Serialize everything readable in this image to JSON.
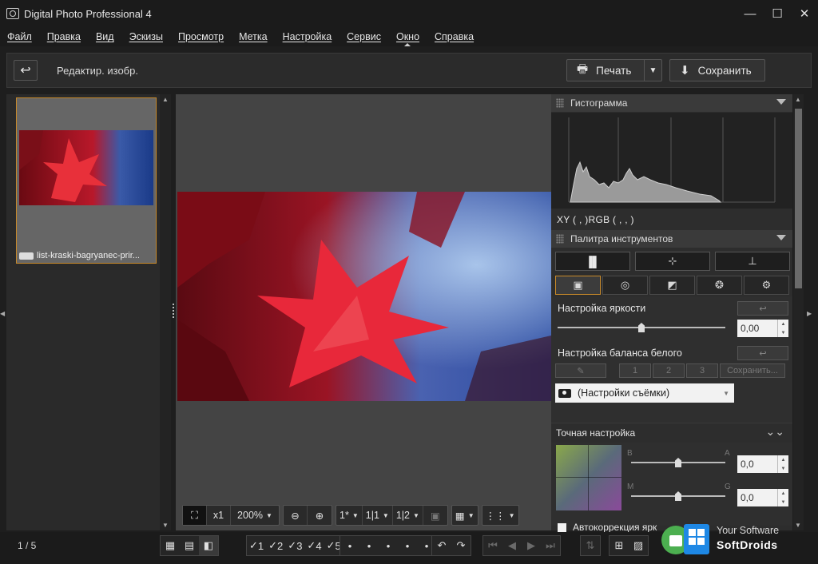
{
  "window": {
    "title": "Digital Photo Professional 4",
    "minimize": "—",
    "maximize": "☐",
    "close": "✕"
  },
  "menu": [
    "Файл",
    "Правка",
    "Вид",
    "Эскизы",
    "Просмотр",
    "Метка",
    "Настройка",
    "Сервис",
    "Окно",
    "Справка"
  ],
  "toolbar": {
    "back_icon": "↩",
    "mode_label": "Редактир. изобр.",
    "print_label": "Печать",
    "save_label": "Сохранить"
  },
  "thumbnail": {
    "filename": "list-kraski-bagryanec-prir..."
  },
  "zoom_bar": {
    "fit_icon": "⛶",
    "one_x": "x1",
    "zoom_value": "200%",
    "zoom_out": "⊖",
    "zoom_in": "⊕",
    "view_1": "1*",
    "view_11": "1|1",
    "view_12": "1|2",
    "grid_icon": "▦",
    "dots_icon": "⋮⋮"
  },
  "histogram": {
    "title": "Гистограмма",
    "readout": "XY (    ,    )RGB (    ,    ,    )"
  },
  "tool_palette": {
    "title": "Палитра инструментов",
    "tool_icons": [
      "▐▌",
      "⊹",
      "⊥"
    ],
    "tab_icons": [
      "▣",
      "◎",
      "◩",
      "❂",
      "⚙"
    ]
  },
  "brightness": {
    "label": "Настройка яркости",
    "value": "0,00",
    "slider_level": 0.5
  },
  "white_balance": {
    "label": "Настройка баланса белого",
    "presets": [
      "1",
      "2",
      "3"
    ],
    "save_label": "Сохранить...",
    "select_value": "(Настройки съёмки)"
  },
  "fine_tune": {
    "label": "Точная настройка",
    "axis_b": "B",
    "axis_a": "A",
    "axis_m": "M",
    "axis_g": "G",
    "value_ba": "0,0",
    "value_mg": "0,0",
    "slider_ba_level": 0.5,
    "slider_mg_level": 0.5
  },
  "auto_correct": {
    "label": "Автокоррекция ярк"
  },
  "status": {
    "page_count": "1 / 5",
    "ratings": [
      "1",
      "2",
      "3",
      "4",
      "5"
    ]
  },
  "watermark": {
    "line1": "Your Software",
    "line2": "SoftDroids"
  },
  "colors": {
    "accent": "#c88a2a",
    "window_bg": "#1e1e1e",
    "panel_bg": "#2d2d2d"
  }
}
